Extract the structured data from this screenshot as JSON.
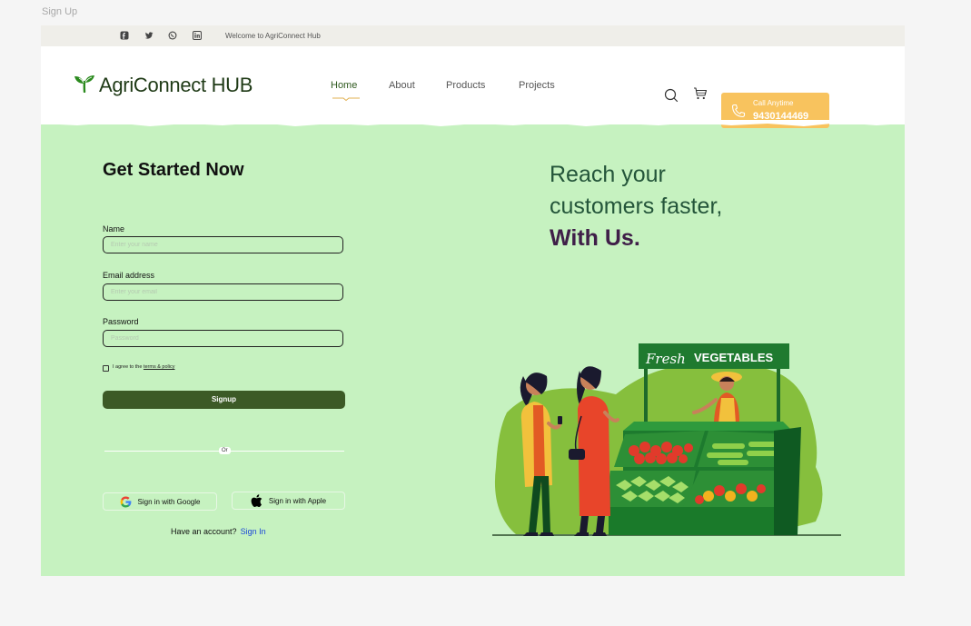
{
  "frame_label": "Sign Up",
  "topbar": {
    "welcome": "Welcome to AgriConnect Hub",
    "social_icons": [
      "facebook-icon",
      "twitter-icon",
      "whatsapp-icon",
      "linkedin-icon"
    ]
  },
  "brand": {
    "name": "AgriConnect HUB",
    "icon": "leaf-sprout-icon"
  },
  "nav": {
    "items": [
      "Home",
      "About",
      "Products",
      "Projects"
    ],
    "active": "Home"
  },
  "call": {
    "label": "Call Anytime",
    "number": "9430144469",
    "icon": "phone-icon"
  },
  "header_icons": [
    "search-icon",
    "cart-icon"
  ],
  "form": {
    "title": "Get Started Now",
    "name_label": "Name",
    "name_placeholder": "Enter your name",
    "email_label": "Email address",
    "email_placeholder": "Enter your email",
    "password_label": "Password",
    "password_placeholder": "Password",
    "agree_text": "I agree to the",
    "terms_link": "terms & policy",
    "signup": "Signup",
    "or": "Or",
    "google": "Sign in with Google",
    "apple": "Sign in with Apple",
    "have_account": "Have an account?",
    "signin": "Sign In"
  },
  "hero": {
    "line1": "Reach your",
    "line2": "customers faster,",
    "line3": "With Us."
  },
  "illustration": {
    "sign_script": "Fresh",
    "sign_text": "VEGETABLES"
  },
  "colors": {
    "background": "#c6f2c0",
    "accent": "#3c5a26",
    "call_button": "#f8c35e",
    "link": "#1a46d8",
    "hero_emphasis": "#3f1f48"
  }
}
